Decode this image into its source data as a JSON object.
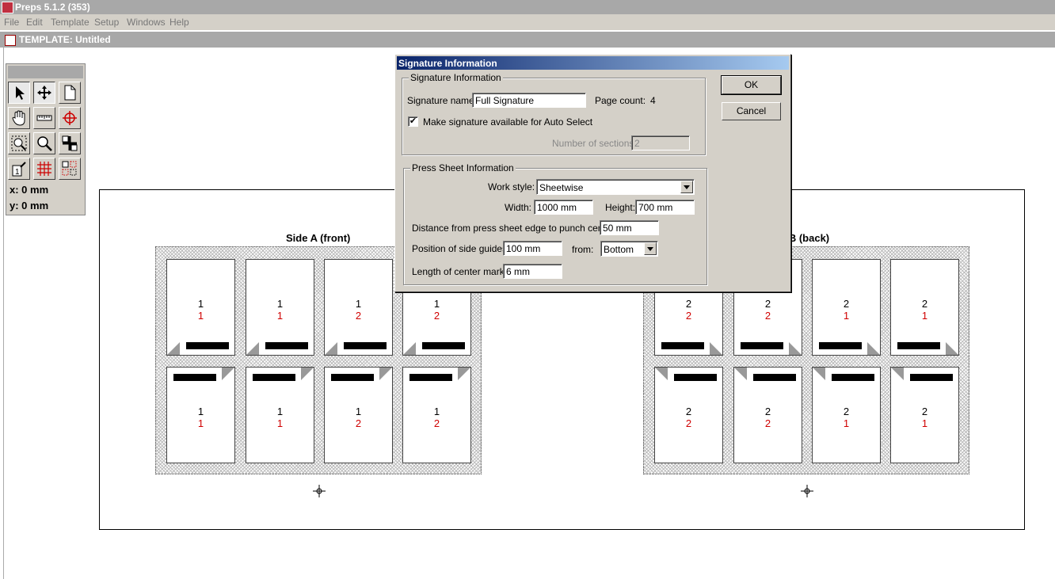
{
  "app": {
    "title": "Preps 5.1.2 (353)"
  },
  "menu": [
    "File",
    "Edit",
    "Template",
    "Setup",
    "Windows",
    "Help"
  ],
  "document": {
    "title": "TEMPLATE: Untitled"
  },
  "palette": {
    "x": "x: 0 mm",
    "y": "y: 0 mm"
  },
  "sheet": {
    "side_a_label": "Side A (front)",
    "side_b_label": "e B (back)",
    "side_a_pages": [
      {
        "top": "1",
        "bottom": "1"
      },
      {
        "top": "1",
        "bottom": "1"
      },
      {
        "top": "1",
        "bottom": "2"
      },
      {
        "top": "1",
        "bottom": "2"
      },
      {
        "top": "1",
        "bottom": "1"
      },
      {
        "top": "1",
        "bottom": "1"
      },
      {
        "top": "1",
        "bottom": "2"
      },
      {
        "top": "1",
        "bottom": "2"
      }
    ],
    "side_b_pages": [
      {
        "top": "2",
        "bottom": "2"
      },
      {
        "top": "2",
        "bottom": "2"
      },
      {
        "top": "2",
        "bottom": "1"
      },
      {
        "top": "2",
        "bottom": "1"
      },
      {
        "top": "2",
        "bottom": "2"
      },
      {
        "top": "2",
        "bottom": "2"
      },
      {
        "top": "2",
        "bottom": "1"
      },
      {
        "top": "2",
        "bottom": "1"
      }
    ]
  },
  "dialog": {
    "title": "Signature Information",
    "ok_label": "OK",
    "cancel_label": "Cancel",
    "sig_group": {
      "label": "Signature Information",
      "name_label": "Signature name:",
      "name_value": "Full Signature",
      "page_count_label": "Page count:",
      "page_count_value": "4",
      "auto_select_label": "Make signature available for Auto Select",
      "auto_select_mark": "✔",
      "sections_label": "Number of sections:",
      "sections_value": "2"
    },
    "press_group": {
      "label": "Press Sheet Information",
      "work_style_label": "Work style:",
      "work_style_value": "Sheetwise",
      "width_label": "Width:",
      "width_value": "1000 mm",
      "height_label": "Height:",
      "height_value": "700 mm",
      "punch_label": "Distance from press sheet edge to punch center:",
      "punch_value": "50 mm",
      "side_guides_label": "Position of side guides:",
      "side_guides_value": "100 mm",
      "from_label": "from:",
      "from_value": "Bottom",
      "center_marks_label": "Length of center marks:",
      "center_marks_value": "6 mm"
    }
  }
}
